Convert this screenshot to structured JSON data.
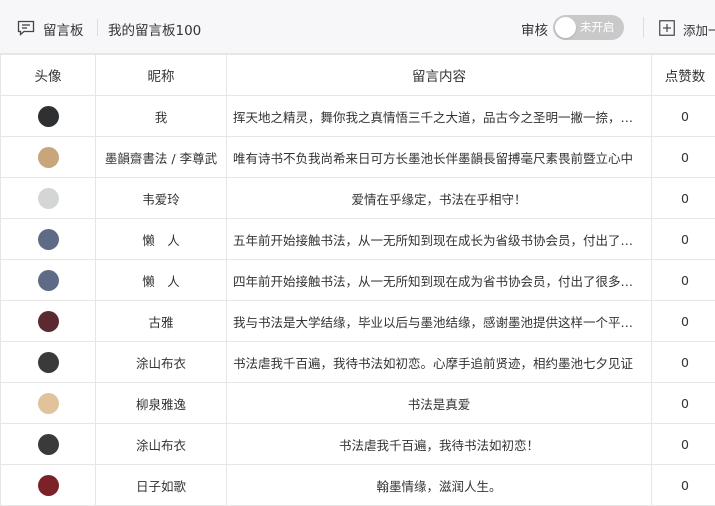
{
  "header": {
    "title": "留言板",
    "board_name": "我的留言板100",
    "audit_label": "审核",
    "audit_toggle_text": "未开启",
    "add_label": "添加一"
  },
  "table": {
    "columns": [
      "头像",
      "昵称",
      "留言内容",
      "点赞数"
    ],
    "rows": [
      {
        "nickname": "我",
        "message": "挥天地之精灵，舞你我之真情悟三千之大道，品古今之圣明一撇一捺，一横一竖皆是人生",
        "likes": "0",
        "align": "left",
        "avatar_color": "#2f3032"
      },
      {
        "nickname": "墨韻齋書法 / 李尊武",
        "message": "唯有诗书不负我尚希来日可方长墨池长伴墨韻長留搏毫尺素畏前暨立心中",
        "likes": "0",
        "align": "left",
        "avatar_color": "#c8a57a"
      },
      {
        "nickname": "韦爱玲",
        "message": "爱情在乎缘定，书法在乎相守！",
        "likes": "0",
        "align": "center",
        "avatar_color": "#d3d6d4"
      },
      {
        "nickname": "懒　人",
        "message": "五年前开始接触书法，从一无所知到现在成长为省级书协会员，付出了很多努力",
        "likes": "0",
        "align": "left",
        "avatar_color": "#5f6b86"
      },
      {
        "nickname": "懒　人",
        "message": "四年前开始接触书法，从一无所知到现在成为省书协会员，付出了很多努力",
        "likes": "0",
        "align": "left",
        "avatar_color": "#5f6b86"
      },
      {
        "nickname": "古雅",
        "message": "我与书法是大学结缘，毕业以后与墨池结缘，感谢墨池提供这样一个平台让我们",
        "likes": "0",
        "align": "left",
        "avatar_color": "#5b2a30"
      },
      {
        "nickname": "涂山布衣",
        "message": "书法虐我千百遍，我待书法如初恋。心摩手追前贤迹，相约墨池七夕见证",
        "likes": "0",
        "align": "left",
        "avatar_color": "#3a3a3a"
      },
      {
        "nickname": "柳泉雅逸",
        "message": "书法是真爱",
        "likes": "0",
        "align": "center",
        "avatar_color": "#e2c29a"
      },
      {
        "nickname": "涂山布衣",
        "message": "书法虐我千百遍，我待书法如初恋！",
        "likes": "0",
        "align": "center",
        "avatar_color": "#3a3a3a"
      },
      {
        "nickname": "日子如歌",
        "message": "翰墨情缘，滋润人生。",
        "likes": "0",
        "align": "center",
        "avatar_color": "#7a2228"
      }
    ]
  }
}
